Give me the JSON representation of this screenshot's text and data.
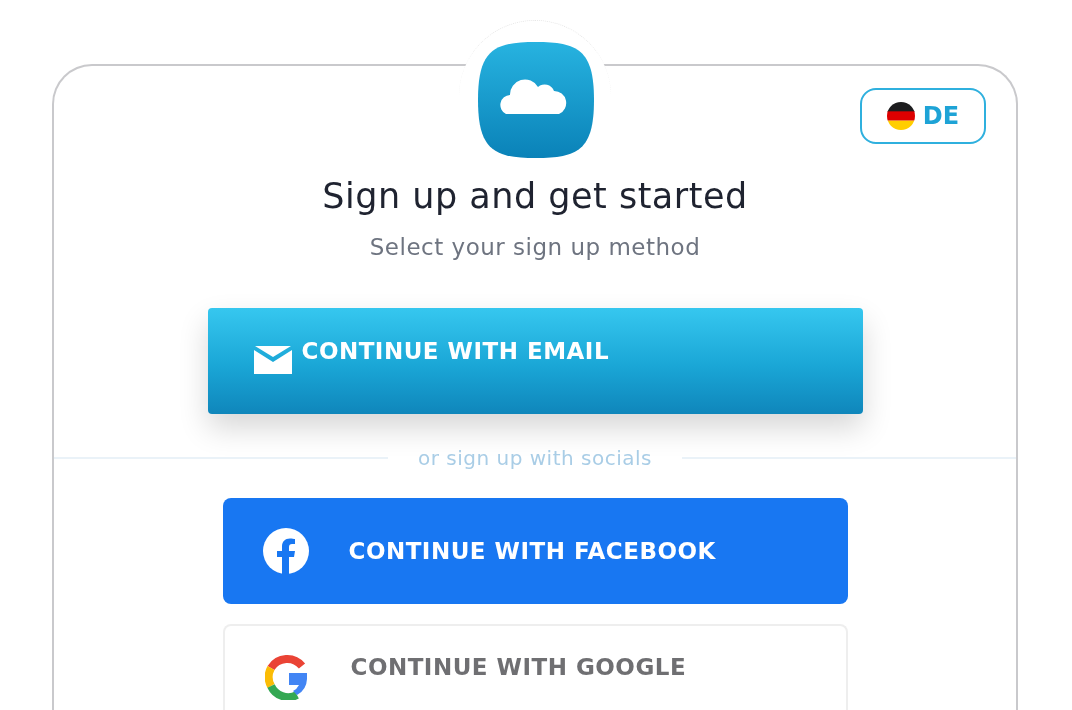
{
  "language_button": {
    "label": "DE"
  },
  "title": "Sign up and get started",
  "subtitle": "Select your sign up method",
  "email_button": {
    "label": "CONTINUE WITH EMAIL"
  },
  "divider_text": "or sign up with socials",
  "social_buttons": [
    {
      "kind": "facebook",
      "label": "CONTINUE WITH FACEBOOK"
    },
    {
      "kind": "google",
      "label": "CONTINUE WITH GOOGLE"
    }
  ]
}
